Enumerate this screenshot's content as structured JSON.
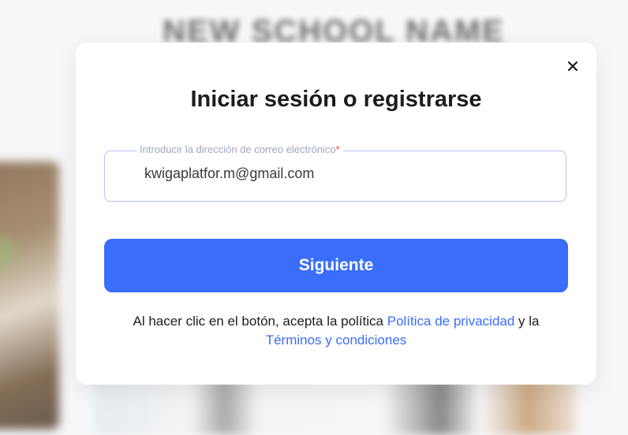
{
  "background": {
    "school_name": "NEW SCHOOL NAME"
  },
  "modal": {
    "title": "Iniciar sesión o registrarse",
    "close_icon": "close-icon",
    "email_field": {
      "label": "Introducir la dirección de correo electrónico",
      "required_mark": "*",
      "value": "kwigaplatfor.m@gmail.com"
    },
    "next_button_label": "Siguiente",
    "consent": {
      "text_before": "Al hacer clic en el botón, acepta la política ",
      "privacy_link": "Política de privacidad",
      "text_between": " y la ",
      "terms_link": "Términos y condiciones"
    }
  },
  "colors": {
    "accent": "#3a6dfa",
    "field_border": "#b9c3f2",
    "label": "#9ea6c2",
    "required": "#e53935"
  }
}
